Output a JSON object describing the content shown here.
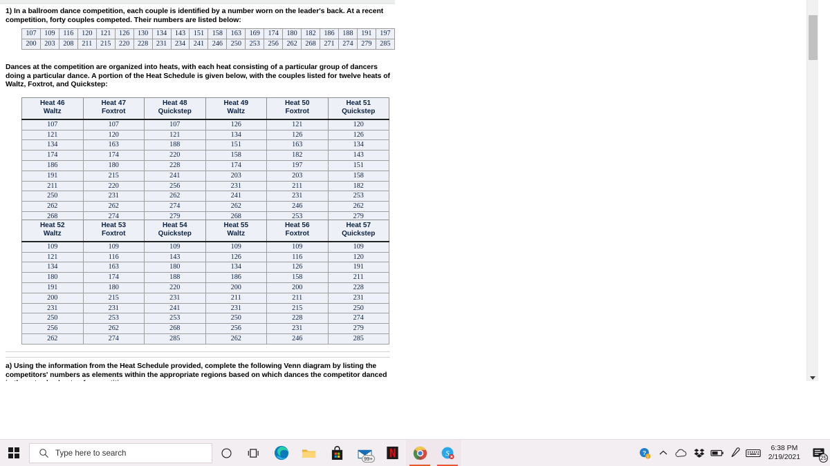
{
  "document": {
    "q1_text": "1) In a ballroom dance competition, each couple is identified by a number worn on the leader's back. At a recent competition, forty couples competed. Their numbers are listed below:",
    "para2_text": "Dances at the competition are organized into heats, with each heat consisting of a particular group of dancers doing a particular dance. A portion of the Heat Schedule is given below, with the couples listed for twelve heats of Waltz, Foxtrot, and Quickstep:",
    "para_a_text": "a) Using the information from the Heat Schedule provided, complete the following Venn diagram by listing the competitors' numbers as elements within the appropriate regions based on which dances the competitor danced in these twelve heats of competition.",
    "numbers_table": {
      "rows": [
        [
          "107",
          "109",
          "116",
          "120",
          "121",
          "126",
          "130",
          "134",
          "143",
          "151",
          "158",
          "163",
          "169",
          "174",
          "180",
          "182",
          "186",
          "188",
          "191",
          "197"
        ],
        [
          "200",
          "203",
          "208",
          "211",
          "215",
          "220",
          "228",
          "231",
          "234",
          "241",
          "246",
          "250",
          "253",
          "256",
          "262",
          "268",
          "271",
          "274",
          "279",
          "285"
        ]
      ]
    },
    "heat_tables": [
      {
        "headers": [
          {
            "heat": "Heat 46",
            "dance": "Waltz"
          },
          {
            "heat": "Heat 47",
            "dance": "Foxtrot"
          },
          {
            "heat": "Heat 48",
            "dance": "Quickstep"
          },
          {
            "heat": "Heat 49",
            "dance": "Waltz"
          },
          {
            "heat": "Heat 50",
            "dance": "Foxtrot"
          },
          {
            "heat": "Heat 51",
            "dance": "Quickstep"
          }
        ],
        "rows": [
          [
            "107",
            "107",
            "107",
            "126",
            "121",
            "120"
          ],
          [
            "121",
            "120",
            "121",
            "134",
            "126",
            "126"
          ],
          [
            "134",
            "163",
            "188",
            "151",
            "163",
            "134"
          ],
          [
            "174",
            "174",
            "220",
            "158",
            "182",
            "143"
          ],
          [
            "186",
            "180",
            "228",
            "174",
            "197",
            "151"
          ],
          [
            "191",
            "215",
            "241",
            "203",
            "203",
            "158"
          ],
          [
            "211",
            "220",
            "256",
            "231",
            "211",
            "182"
          ],
          [
            "250",
            "231",
            "262",
            "241",
            "231",
            "253"
          ],
          [
            "262",
            "262",
            "274",
            "262",
            "246",
            "262"
          ],
          [
            "268",
            "274",
            "279",
            "268",
            "253",
            "279"
          ]
        ]
      },
      {
        "headers": [
          {
            "heat": "Heat 52",
            "dance": "Waltz"
          },
          {
            "heat": "Heat 53",
            "dance": "Foxtrot"
          },
          {
            "heat": "Heat 54",
            "dance": "Quickstep"
          },
          {
            "heat": "Heat 55",
            "dance": "Waltz"
          },
          {
            "heat": "Heat 56",
            "dance": "Foxtrot"
          },
          {
            "heat": "Heat 57",
            "dance": "Quickstep"
          }
        ],
        "rows": [
          [
            "109",
            "109",
            "109",
            "109",
            "109",
            "109"
          ],
          [
            "121",
            "116",
            "143",
            "126",
            "116",
            "120"
          ],
          [
            "134",
            "163",
            "180",
            "134",
            "126",
            "191"
          ],
          [
            "180",
            "174",
            "188",
            "186",
            "158",
            "211"
          ],
          [
            "191",
            "180",
            "220",
            "200",
            "200",
            "228"
          ],
          [
            "200",
            "215",
            "231",
            "211",
            "211",
            "231"
          ],
          [
            "231",
            "231",
            "241",
            "231",
            "215",
            "250"
          ],
          [
            "250",
            "253",
            "253",
            "250",
            "228",
            "274"
          ],
          [
            "256",
            "262",
            "268",
            "256",
            "231",
            "279"
          ],
          [
            "262",
            "274",
            "285",
            "262",
            "246",
            "285"
          ]
        ]
      }
    ]
  },
  "taskbar": {
    "start_label": "windows-start",
    "search_placeholder": "Type here to search",
    "apps": [
      {
        "name": "cortana-icon",
        "label": "Cortana"
      },
      {
        "name": "task-view-icon",
        "label": "Task View"
      },
      {
        "name": "edge-icon",
        "label": "Microsoft Edge"
      },
      {
        "name": "file-explorer-icon",
        "label": "File Explorer"
      },
      {
        "name": "microsoft-store-icon",
        "label": "Microsoft Store"
      },
      {
        "name": "mail-icon",
        "label": "Mail"
      },
      {
        "name": "netflix-icon",
        "label": "Netflix"
      },
      {
        "name": "chrome-icon",
        "label": "Google Chrome"
      },
      {
        "name": "skype-icon",
        "label": "Skype"
      }
    ],
    "mail_badge": "99+",
    "netflix_letter": "N",
    "skype_letter": "S",
    "tray": [
      {
        "name": "help-icon",
        "label": "Help"
      },
      {
        "name": "show-hidden-icons-chevron",
        "label": "Show hidden icons"
      },
      {
        "name": "onedrive-icon",
        "label": "OneDrive"
      },
      {
        "name": "dropbox-icon",
        "label": "Dropbox"
      },
      {
        "name": "battery-icon",
        "label": "Battery"
      },
      {
        "name": "pen-icon",
        "label": "Windows Ink"
      },
      {
        "name": "keyboard-icon",
        "label": "Touch keyboard"
      }
    ],
    "clock_time": "6:38 PM",
    "clock_date": "2/19/2021",
    "notification_count": "25"
  },
  "colors": {
    "table_fill": "#eef0f8",
    "table_text": "#0b2240",
    "taskbar_bg": "#f3eef1",
    "accent_underline": "#e8542f"
  }
}
